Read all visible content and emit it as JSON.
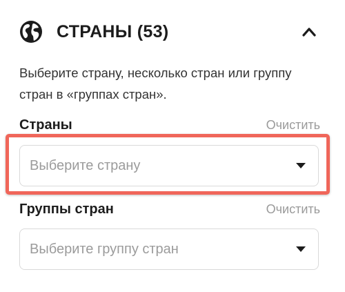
{
  "section": {
    "title": "СТРАНЫ (53)",
    "icon": "globe-icon",
    "collapse_icon": "chevron-up-icon",
    "description": "Выберите страну, несколько стран или группу стран в «группах стран»."
  },
  "countries": {
    "label": "Страны",
    "clear_label": "Очистить",
    "placeholder": "Выберите страну",
    "caret_icon": "caret-down-icon"
  },
  "groups": {
    "label": "Группы стран",
    "clear_label": "Очистить",
    "placeholder": "Выберите группу стран",
    "caret_icon": "caret-down-icon"
  },
  "colors": {
    "highlight": "#f0665a",
    "text": "#1c1c1c",
    "muted": "#9b9b9b"
  }
}
